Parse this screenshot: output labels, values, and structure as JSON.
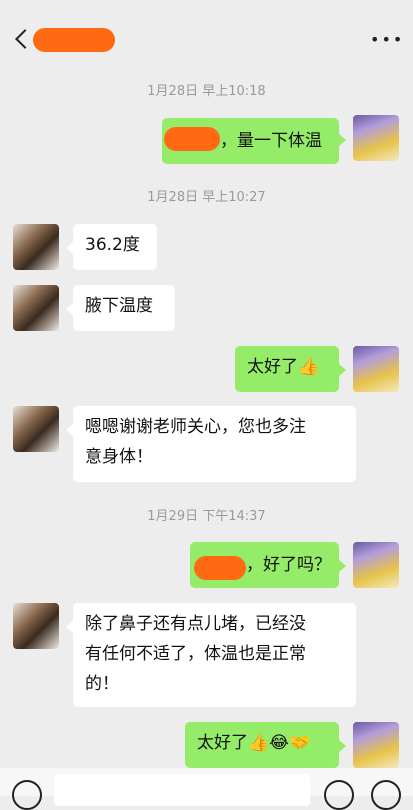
{
  "header": {
    "more_label": "•••"
  },
  "messages": [
    {
      "type": "time",
      "text": "1月28日 早上10:18"
    },
    {
      "type": "out",
      "text": "，量一下体温"
    },
    {
      "type": "time",
      "text": "1月28日 早上10:27"
    },
    {
      "type": "in",
      "text": "36.2度"
    },
    {
      "type": "in",
      "text": "腋下温度"
    },
    {
      "type": "out",
      "text": "太好了👍"
    },
    {
      "type": "in",
      "lines": [
        "嗯嗯谢谢老师关心，您也多注",
        "意身体！"
      ]
    },
    {
      "type": "time",
      "text": "1月29日 下午14:37"
    },
    {
      "type": "out",
      "text": "，好了吗？"
    },
    {
      "type": "in",
      "lines": [
        "除了鼻子还有点儿堵，已经没",
        "有任何不适了，体温也是正常",
        "的！"
      ]
    },
    {
      "type": "out",
      "text": "太好了👍😂🤝"
    }
  ],
  "colors": {
    "background": "#ededed",
    "bubble_out": "#95ec69",
    "bubble_in": "#ffffff",
    "redaction": "#ff6a13"
  },
  "icons": {
    "back": "chevron-left-icon",
    "more": "more-icon",
    "voice": "voice-icon",
    "emoji": "emoji-icon",
    "add": "plus-icon"
  }
}
